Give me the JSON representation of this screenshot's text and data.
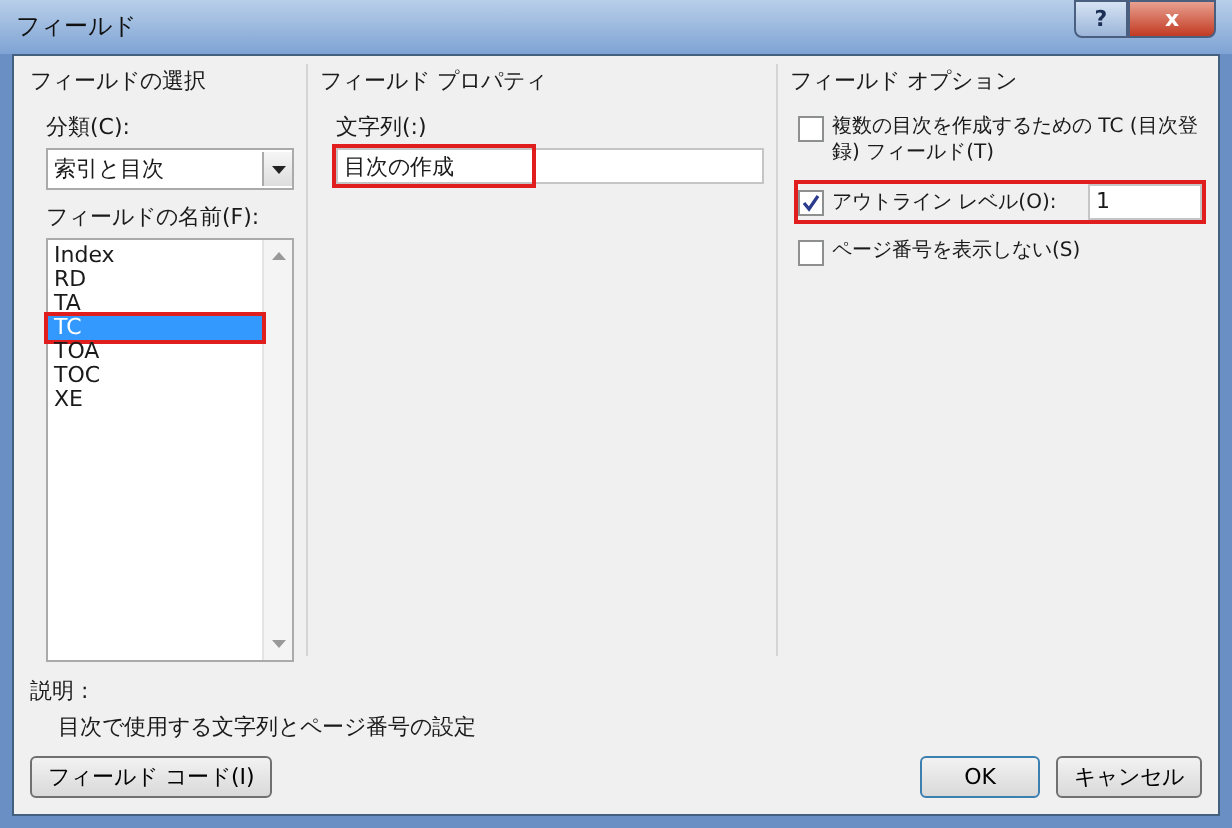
{
  "window": {
    "title": "フィールド",
    "help_button": "?",
    "close_button": "x"
  },
  "field_selection": {
    "heading": "フィールドの選択",
    "category_label": "分類(C):",
    "category_value": "索引と目次",
    "names_label": "フィールドの名前(F):",
    "names": [
      {
        "label": "Index",
        "selected": false,
        "highlighted": false
      },
      {
        "label": "RD",
        "selected": false,
        "highlighted": false
      },
      {
        "label": "TA",
        "selected": false,
        "highlighted": false
      },
      {
        "label": "TC",
        "selected": true,
        "highlighted": true
      },
      {
        "label": "TOA",
        "selected": false,
        "highlighted": false
      },
      {
        "label": "TOC",
        "selected": false,
        "highlighted": false
      },
      {
        "label": "XE",
        "selected": false,
        "highlighted": false
      }
    ]
  },
  "field_properties": {
    "heading": "フィールド プロパティ",
    "text_label": "文字列(:)",
    "text_value": "目次の作成",
    "highlighted": true
  },
  "field_options": {
    "heading": "フィールド オプション",
    "options": [
      {
        "kind": "checkbox",
        "label": "複数の目次を作成するための TC (目次登録) フィールド(T)",
        "checked": false,
        "highlighted": false
      },
      {
        "kind": "checkbox-input",
        "label": "アウトライン レベル(O):",
        "checked": true,
        "value": "1",
        "highlighted": true
      },
      {
        "kind": "checkbox",
        "label": "ページ番号を表示しない(S)",
        "checked": false,
        "highlighted": false
      }
    ]
  },
  "description": {
    "label": "説明 :",
    "text": "目次で使用する文字列とページ番号の設定"
  },
  "buttons": {
    "field_code": "フィールド コード(I)",
    "ok": "OK",
    "cancel": "キャンセル"
  }
}
